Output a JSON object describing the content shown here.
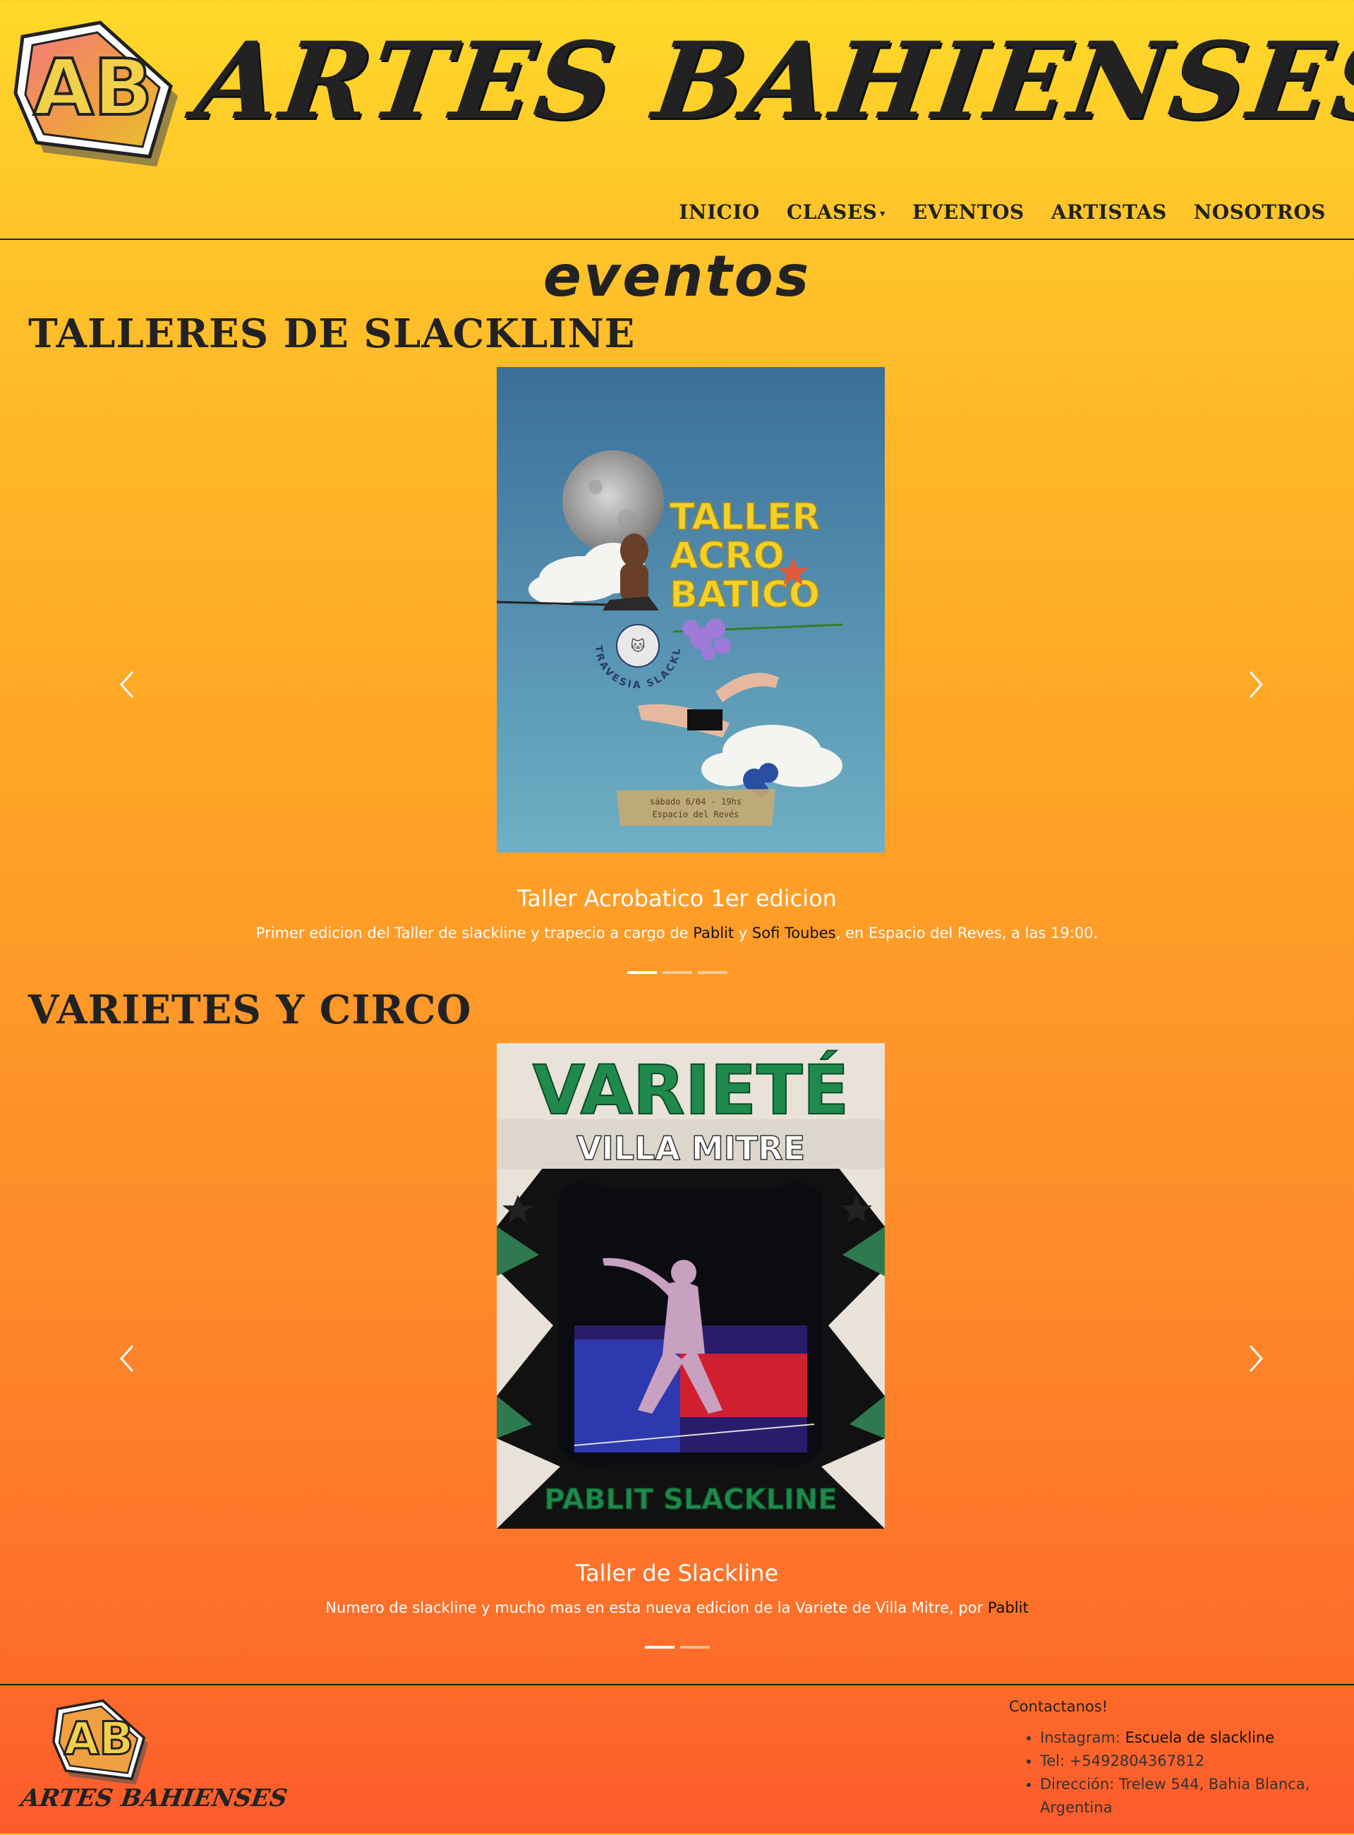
{
  "brand": {
    "logo_letters": "AB",
    "title": "ARTES BAHIENSES"
  },
  "nav": {
    "items": [
      {
        "label": "INICIO"
      },
      {
        "label": "CLASES",
        "has_dropdown": true
      },
      {
        "label": "EVENTOS"
      },
      {
        "label": "ARTISTAS"
      },
      {
        "label": "NOSOTROS"
      }
    ],
    "caret_glyph": "▾"
  },
  "page": {
    "title": "eventos"
  },
  "sections": [
    {
      "heading": "TALLERES DE SLACKLINE",
      "poster": {
        "title_lines": [
          "TALLER",
          "ACRO",
          "BATICO"
        ],
        "ring_text": "TRAVESIA SLACKLINE",
        "date_line": "sábado 6/04 - 19hs",
        "place_line": "Espacio del Revés"
      },
      "caption": {
        "title": "Taller Acrobatico 1er edicion",
        "text_before": "Primer edicion del Taller de slackline y trapecio a cargo de ",
        "link1": "Pablit",
        "text_mid": " y ",
        "link2": "Sofi Toubes",
        "text_after": ", en Espacio del Reves, a las 19:00."
      },
      "slides": 3,
      "active_slide": 0
    },
    {
      "heading": "VARIETES Y CIRCO",
      "poster": {
        "title": "VARIETÉ",
        "subtitle": "VILLA MITRE",
        "bottom": "PABLIT SLACKLINE"
      },
      "caption": {
        "title": "Taller de Slackline",
        "text_before": "Numero de slackline y mucho mas en esta nueva edicion de la Variete de Villa Mitre, por ",
        "link1": "Pablit"
      },
      "slides": 2,
      "active_slide": 0
    }
  ],
  "arrows": {
    "prev_icon": "chevron-left-icon",
    "next_icon": "chevron-right-icon"
  },
  "footer": {
    "brand": "ARTES BAHIENSES",
    "contact_title": "Contactanos!",
    "instagram_label": "Instagram: ",
    "instagram_link": "Escuela de slackline",
    "tel": "Tel: +5492804367812",
    "address": "Dirección: Trelew 544, Bahia Blanca, Argentina"
  },
  "colors": {
    "gradient_top": "#ffd928",
    "gradient_bottom": "#fd5a2c",
    "text_dark": "#222222",
    "caption_white": "#ffffff"
  }
}
